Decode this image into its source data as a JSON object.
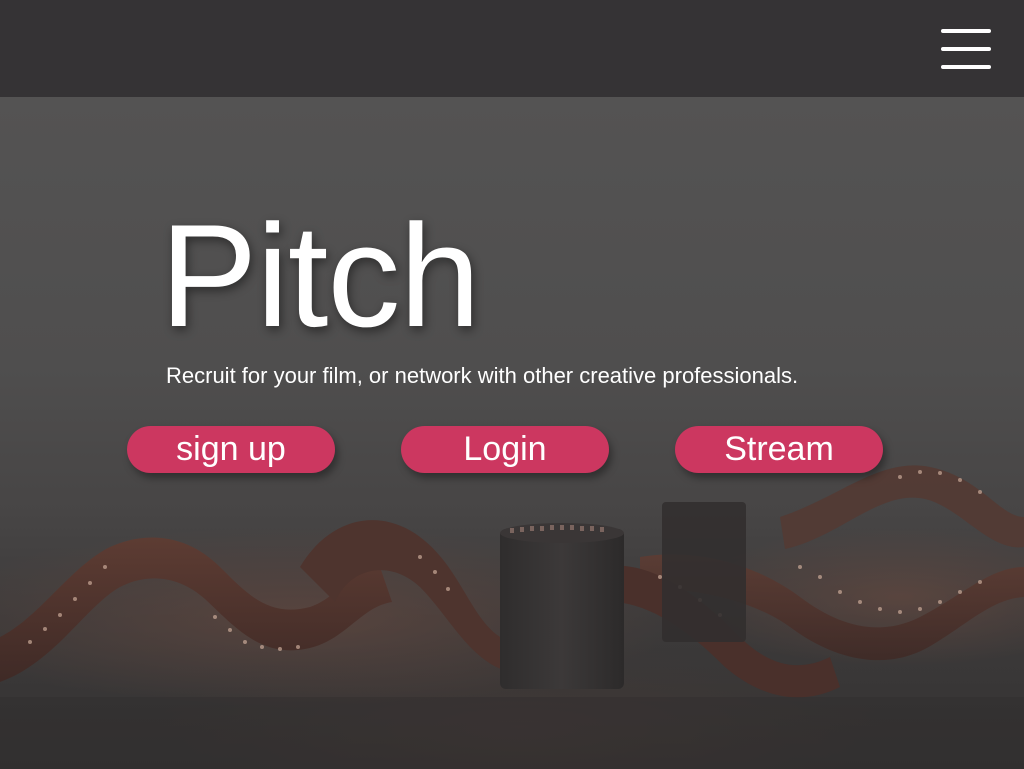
{
  "header": {
    "menu_icon": "hamburger-menu-icon"
  },
  "hero": {
    "title": "Pitch",
    "subtitle": "Recruit for your film, or network with other creative professionals.",
    "background_image": "film-reel-photo"
  },
  "actions": {
    "signup_label": "sign up",
    "login_label": "Login",
    "stream_label": "Stream"
  },
  "colors": {
    "topbar": "#353335",
    "button": "#cc3760",
    "text": "#ffffff"
  }
}
